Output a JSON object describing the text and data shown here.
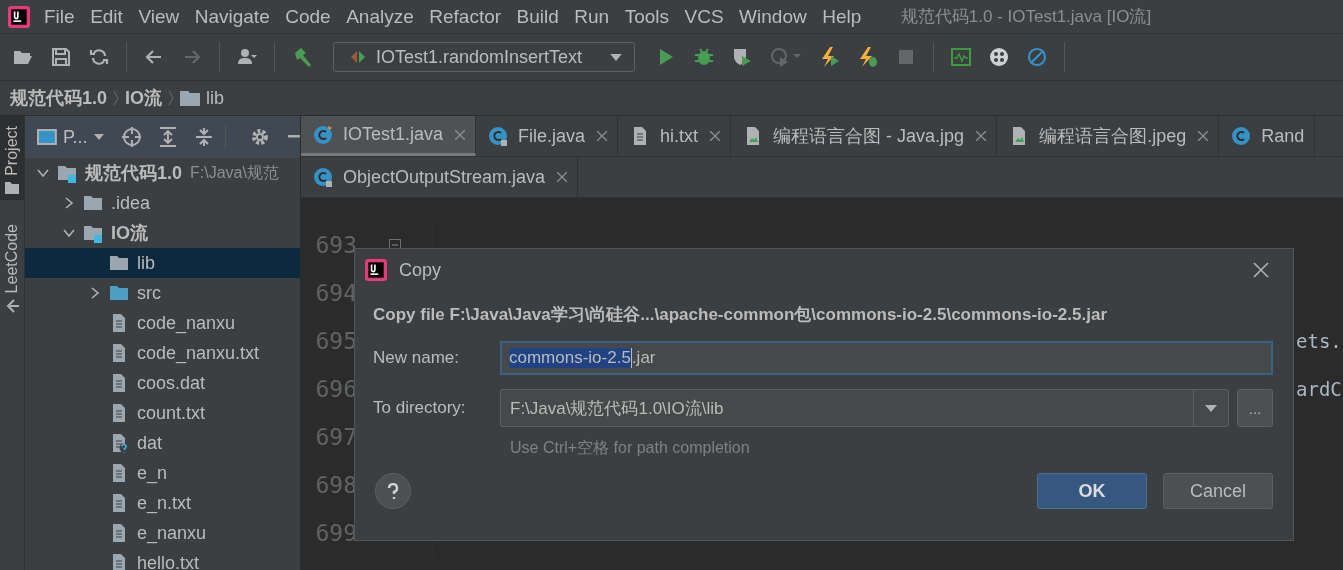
{
  "window": {
    "title": "规范代码1.0 - IOTest1.java [IO流]"
  },
  "menu": [
    "File",
    "Edit",
    "View",
    "Navigate",
    "Code",
    "Analyze",
    "Refactor",
    "Build",
    "Run",
    "Tools",
    "VCS",
    "Window",
    "Help"
  ],
  "toolbar": {
    "left": [
      {
        "kind": "open",
        "disabled": false
      },
      {
        "kind": "save",
        "disabled": false
      },
      {
        "kind": "sync",
        "disabled": false
      },
      {
        "kind": "sep"
      },
      {
        "kind": "back",
        "disabled": false
      },
      {
        "kind": "forward",
        "disabled": true
      },
      {
        "kind": "sep"
      },
      {
        "kind": "user",
        "disabled": false
      },
      {
        "kind": "sep"
      },
      {
        "kind": "build",
        "disabled": false
      }
    ],
    "run_config": "IOTest1.randomInsertText",
    "right": [
      {
        "kind": "run",
        "disabled": false
      },
      {
        "kind": "debug",
        "disabled": false
      },
      {
        "kind": "coverage",
        "disabled": false
      },
      {
        "kind": "profile",
        "disabled": true
      },
      {
        "kind": "bolt-run",
        "disabled": false
      },
      {
        "kind": "bolt-debug",
        "disabled": false
      },
      {
        "kind": "stop",
        "disabled": true
      },
      {
        "kind": "sep"
      },
      {
        "kind": "monitor",
        "disabled": false
      },
      {
        "kind": "plugin",
        "disabled": false
      },
      {
        "kind": "block",
        "disabled": false
      },
      {
        "kind": "sep"
      }
    ]
  },
  "breadcrumb": [
    {
      "label": "规范代码1.0",
      "kind": "module"
    },
    {
      "label": "IO流",
      "kind": "module"
    },
    {
      "label": "lib",
      "kind": "folder"
    }
  ],
  "side_strip": [
    {
      "label": "Project",
      "selected": true
    },
    {
      "label": "LeetCode",
      "selected": false
    }
  ],
  "project_panel": {
    "title": "P...",
    "tree": [
      {
        "label": "规范代码1.0",
        "note": "F:\\Java\\规范",
        "kind": "module",
        "expanded": true,
        "selected": false,
        "children": [
          {
            "label": ".idea",
            "kind": "folder",
            "expanded": false,
            "selected": false
          },
          {
            "label": "IO流",
            "kind": "module",
            "expanded": true,
            "selected": false,
            "children": [
              {
                "label": "lib",
                "kind": "folder",
                "selected": true
              },
              {
                "label": "src",
                "kind": "source",
                "expanded": false,
                "selected": false
              },
              {
                "label": "code_nanxu",
                "kind": "file",
                "selected": false
              },
              {
                "label": "code_nanxu.txt",
                "kind": "file",
                "selected": false
              },
              {
                "label": "coos.dat",
                "kind": "file",
                "selected": false
              },
              {
                "label": "count.txt",
                "kind": "file",
                "selected": false
              },
              {
                "label": "dat",
                "kind": "unknown",
                "selected": false
              },
              {
                "label": "e_n",
                "kind": "file",
                "selected": false
              },
              {
                "label": "e_n.txt",
                "kind": "file",
                "selected": false
              },
              {
                "label": "e_nanxu",
                "kind": "file",
                "selected": false
              },
              {
                "label": "hello.txt",
                "kind": "file",
                "selected": false
              }
            ]
          }
        ]
      }
    ]
  },
  "editor_tabs": [
    [
      {
        "label": "IOTest1.java",
        "kind": "class",
        "selected": true,
        "closable": true
      },
      {
        "label": "File.java",
        "kind": "locked-class",
        "selected": false,
        "closable": true
      },
      {
        "label": "hi.txt",
        "kind": "text",
        "selected": false,
        "closable": true
      },
      {
        "label": "编程语言合图 - Java.jpg",
        "kind": "image",
        "selected": false,
        "closable": true
      },
      {
        "label": "编程语言合图.jpeg",
        "kind": "image",
        "selected": false,
        "closable": true
      },
      {
        "label": "Rand",
        "kind": "class",
        "selected": false,
        "closable": false
      }
    ],
    [
      {
        "label": "ObjectOutputStream.java",
        "kind": "locked-class",
        "selected": false,
        "closable": true
      }
    ]
  ],
  "code_lines": [
    {
      "number": "693",
      "fold": true
    },
    {
      "number": "694"
    },
    {
      "number": "695",
      "segments": [
        {
          "kind": "tail",
          "text": "ets."
        }
      ]
    },
    {
      "number": "696",
      "segments": [
        {
          "kind": "tail",
          "text": "ardC"
        }
      ]
    },
    {
      "number": "697"
    },
    {
      "number": "698"
    },
    {
      "number": "699"
    }
  ],
  "dialog": {
    "title": "Copy",
    "message": "Copy file F:\\Java\\Java学习\\尚硅谷...\\apache-common包\\commons-io-2.5\\commons-io-2.5.jar",
    "new_name": {
      "label": "New name:",
      "selected_part": "commons-io-2.5",
      "rest": ".jar"
    },
    "to_directory": {
      "label": "To directory:",
      "value": "F:\\Java\\规范代码1.0\\IO流\\lib",
      "browse": "..."
    },
    "hint": "Use Ctrl+空格 for path completion",
    "buttons": [
      {
        "label": "OK",
        "default": true
      },
      {
        "label": "Cancel",
        "default": false
      }
    ]
  }
}
